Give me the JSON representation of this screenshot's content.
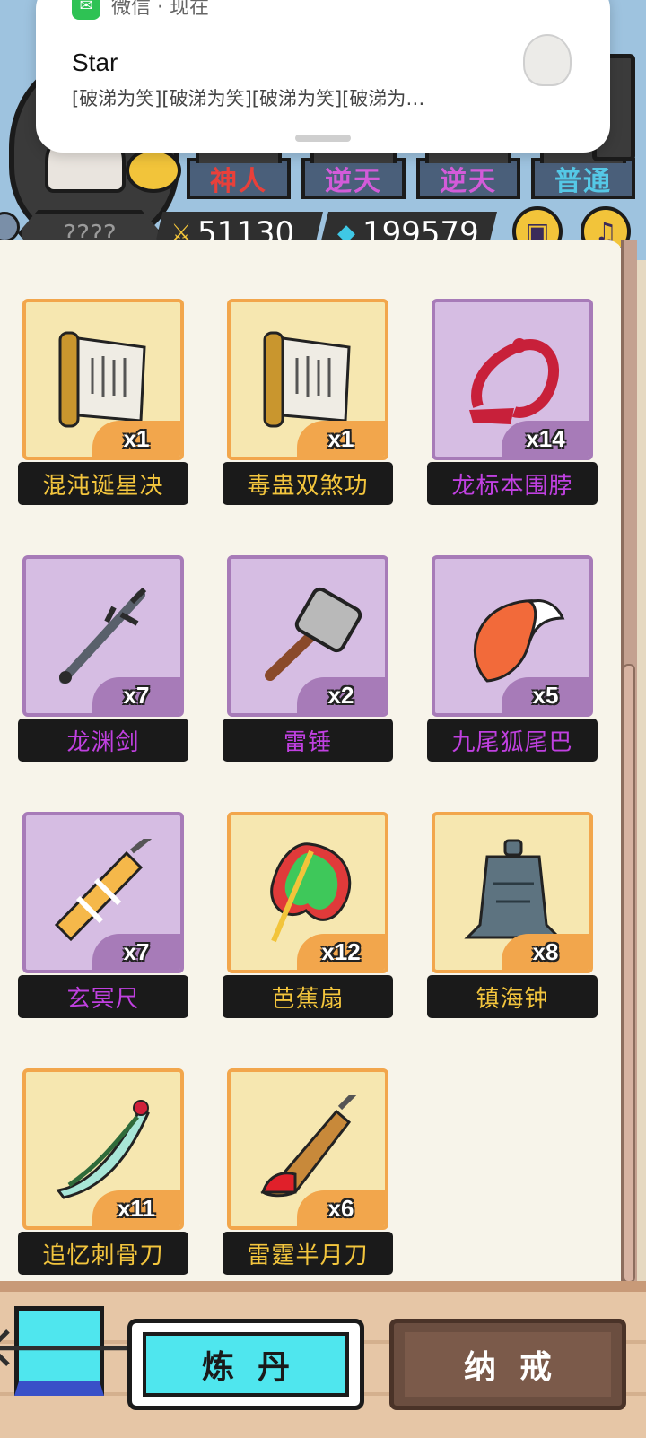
{
  "notification": {
    "app_name": "微信 · 现在",
    "title": "Star",
    "message": "[破涕为笑][破涕为笑][破涕为笑][破涕为…"
  },
  "header": {
    "ranks": [
      "神人",
      "逆天",
      "逆天",
      "普通"
    ],
    "rank_colors": [
      "#e8403a",
      "#d35bd9",
      "#d35bd9",
      "#55c8e6"
    ],
    "player_name": "????",
    "sword_count": "51130",
    "crystal_count": "199579"
  },
  "inventory": {
    "items": [
      {
        "name": "混沌诞星决",
        "qty": "x1",
        "rarity": "legend",
        "icon": "scroll-icon"
      },
      {
        "name": "毒蛊双煞功",
        "qty": "x1",
        "rarity": "legend",
        "icon": "scroll-icon"
      },
      {
        "name": "龙标本围脖",
        "qty": "x14",
        "rarity": "epic",
        "icon": "dragon-scarf-icon"
      },
      {
        "name": "龙渊剑",
        "qty": "x7",
        "rarity": "epic",
        "icon": "spiked-sword-icon"
      },
      {
        "name": "雷锤",
        "qty": "x2",
        "rarity": "epic",
        "icon": "hammer-icon"
      },
      {
        "name": "九尾狐尾巴",
        "qty": "x5",
        "rarity": "epic",
        "icon": "fox-tail-icon"
      },
      {
        "name": "玄冥尺",
        "qty": "x7",
        "rarity": "epic",
        "icon": "ruler-sword-icon"
      },
      {
        "name": "芭蕉扇",
        "qty": "x12",
        "rarity": "legend",
        "icon": "banana-fan-icon"
      },
      {
        "name": "镇海钟",
        "qty": "x8",
        "rarity": "legend",
        "icon": "bell-icon"
      },
      {
        "name": "追忆刺骨刀",
        "qty": "x11",
        "rarity": "legend",
        "icon": "rose-blade-icon"
      },
      {
        "name": "雷霆半月刀",
        "qty": "x6",
        "rarity": "legend",
        "icon": "crescent-blade-icon"
      }
    ]
  },
  "bottom_bar": {
    "back_icon": "arrow-left-icon",
    "craft_label": "炼丹",
    "ring_label": "纳戒"
  }
}
